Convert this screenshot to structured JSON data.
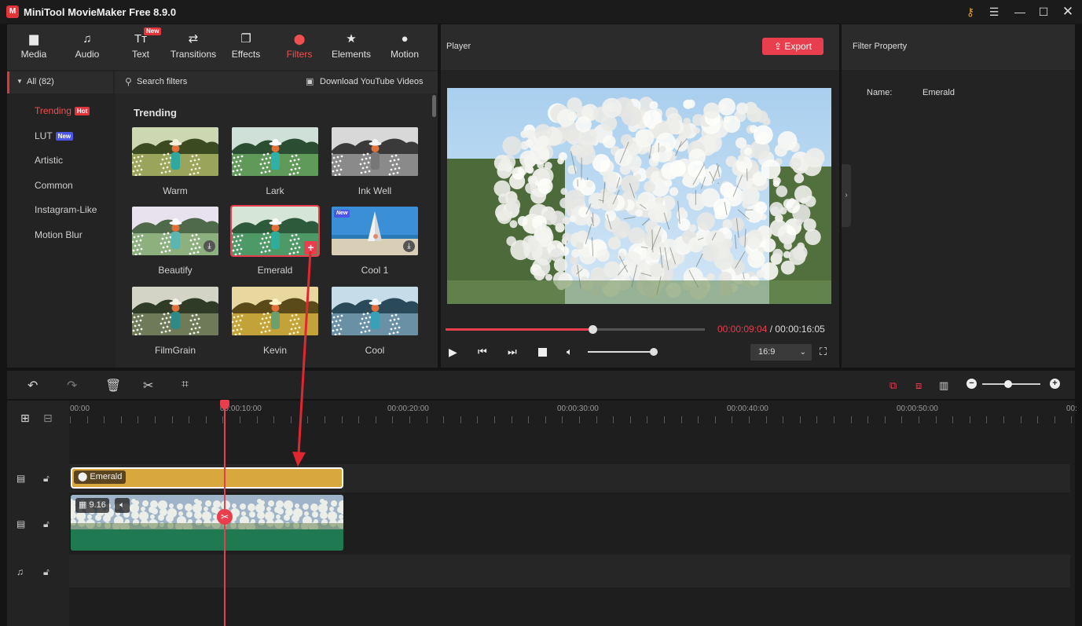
{
  "window": {
    "title": "MiniTool MovieMaker Free 8.9.0",
    "logo_letter": "M",
    "controls": [
      "key-icon",
      "menu-icon",
      "minimize-icon",
      "maximize-icon",
      "close-icon"
    ]
  },
  "tabs": [
    {
      "label": "Media",
      "icon": "folder-icon",
      "glyph": "▆"
    },
    {
      "label": "Audio",
      "icon": "music-note-icon",
      "glyph": "♫"
    },
    {
      "label": "Text",
      "icon": "text-icon",
      "glyph": "Tт",
      "badge": "New"
    },
    {
      "label": "Transitions",
      "icon": "transition-arrows-icon",
      "glyph": "⇄"
    },
    {
      "label": "Effects",
      "icon": "effects-icon",
      "glyph": "❐"
    },
    {
      "label": "Filters",
      "icon": "filters-icon",
      "glyph": "⬤",
      "active": true
    },
    {
      "label": "Elements",
      "icon": "elements-icon",
      "glyph": "★"
    },
    {
      "label": "Motion",
      "icon": "motion-icon",
      "glyph": "●"
    }
  ],
  "sidebar": {
    "all_label": "All (82)",
    "items": [
      {
        "label": "Trending",
        "badge": "Hot",
        "badge_color": "#e2353b",
        "active": true
      },
      {
        "label": "LUT",
        "badge": "New",
        "badge_color": "#4b56e6"
      },
      {
        "label": "Artistic"
      },
      {
        "label": "Common"
      },
      {
        "label": "Instagram-Like"
      },
      {
        "label": "Motion Blur"
      }
    ]
  },
  "search": {
    "placeholder": "Search filters",
    "download_label": "Download YouTube Videos"
  },
  "filters": {
    "section_title": "Trending",
    "items": [
      {
        "label": "Warm",
        "tone": "warm"
      },
      {
        "label": "Lark",
        "tone": "lark"
      },
      {
        "label": "Ink Well",
        "tone": "bw"
      },
      {
        "label": "Beautify",
        "tone": "beautify",
        "download": true
      },
      {
        "label": "Emerald",
        "tone": "emerald",
        "selected": true,
        "add": true
      },
      {
        "label": "Cool 1",
        "tone": "sail",
        "download": true,
        "badge": "New"
      },
      {
        "label": "FilmGrain",
        "tone": "film"
      },
      {
        "label": "Kevin",
        "tone": "kevin"
      },
      {
        "label": "Cool",
        "tone": "cool"
      }
    ]
  },
  "player": {
    "title": "Player",
    "export_label": "Export",
    "current_time": "00:00:09:04",
    "separator": " / ",
    "total_time": "00:00:16:05",
    "progress": 0.568,
    "volume": 0.9,
    "aspect_ratio": "16:9",
    "accent": "#e83e4d"
  },
  "property": {
    "title": "Filter Property",
    "name_label": "Name:",
    "name_value": "Emerald"
  },
  "timeline": {
    "ticks": [
      "00:00",
      "00:00:10:00",
      "00:00:20:00",
      "00:00:30:00",
      "00:00:40:00",
      "00:00:50:00",
      "00:"
    ],
    "filter_clip_label": "Emerald",
    "video_clip_duration": "9.16",
    "filter_clip_color": "#d8a73e",
    "video_clip_color": "#1f7a52"
  }
}
